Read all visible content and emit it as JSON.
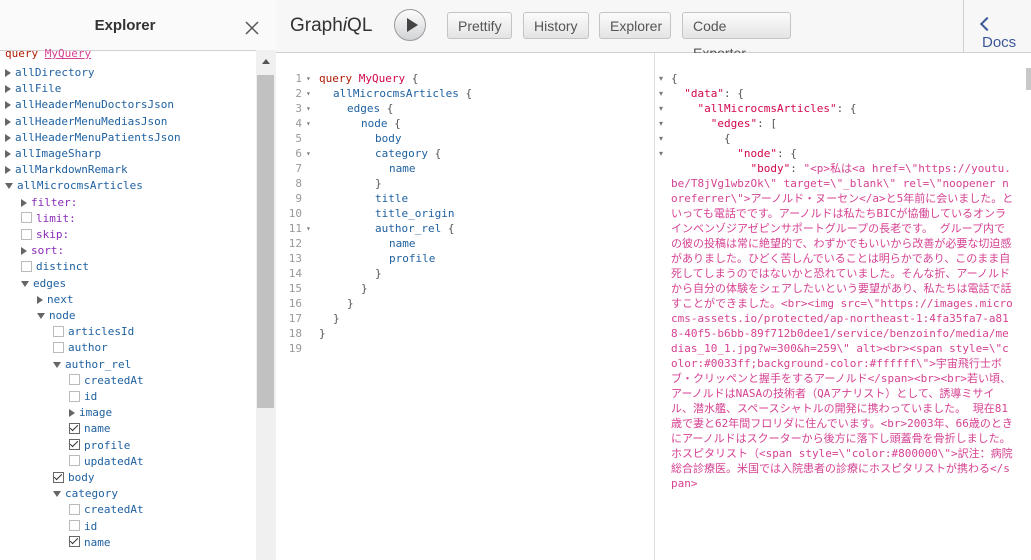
{
  "explorer": {
    "title": "Explorer",
    "query_keyword": "query",
    "query_name": "MyQuery",
    "items": [
      {
        "text": "allDirectory",
        "indent": 0,
        "kind": "arrow-right"
      },
      {
        "text": "allFile",
        "indent": 0,
        "kind": "arrow-right"
      },
      {
        "text": "allHeaderMenuDoctorsJson",
        "indent": 0,
        "kind": "arrow-right"
      },
      {
        "text": "allHeaderMenuMediasJson",
        "indent": 0,
        "kind": "arrow-right"
      },
      {
        "text": "allHeaderMenuPatientsJson",
        "indent": 0,
        "kind": "arrow-right"
      },
      {
        "text": "allImageSharp",
        "indent": 0,
        "kind": "arrow-right"
      },
      {
        "text": "allMarkdownRemark",
        "indent": 0,
        "kind": "arrow-right"
      },
      {
        "text": "allMicrocmsArticles",
        "indent": 0,
        "kind": "arrow-down"
      },
      {
        "text": "filter:",
        "indent": 1,
        "kind": "arrow-right",
        "arg": true
      },
      {
        "text": "limit:",
        "indent": 1,
        "kind": "cb-off",
        "arg": true
      },
      {
        "text": "skip:",
        "indent": 1,
        "kind": "cb-off",
        "arg": true
      },
      {
        "text": "sort:",
        "indent": 1,
        "kind": "arrow-right",
        "arg": true
      },
      {
        "text": "distinct",
        "indent": 1,
        "kind": "cb-off"
      },
      {
        "text": "edges",
        "indent": 1,
        "kind": "arrow-down"
      },
      {
        "text": "next",
        "indent": 2,
        "kind": "arrow-right"
      },
      {
        "text": "node",
        "indent": 2,
        "kind": "arrow-down"
      },
      {
        "text": "articlesId",
        "indent": 3,
        "kind": "cb-off"
      },
      {
        "text": "author",
        "indent": 3,
        "kind": "cb-off"
      },
      {
        "text": "author_rel",
        "indent": 3,
        "kind": "arrow-down"
      },
      {
        "text": "createdAt",
        "indent": 4,
        "kind": "cb-off"
      },
      {
        "text": "id",
        "indent": 4,
        "kind": "cb-off"
      },
      {
        "text": "image",
        "indent": 4,
        "kind": "arrow-right"
      },
      {
        "text": "name",
        "indent": 4,
        "kind": "cb-on"
      },
      {
        "text": "profile",
        "indent": 4,
        "kind": "cb-on"
      },
      {
        "text": "updatedAt",
        "indent": 4,
        "kind": "cb-off"
      },
      {
        "text": "body",
        "indent": 3,
        "kind": "cb-on"
      },
      {
        "text": "category",
        "indent": 3,
        "kind": "arrow-down"
      },
      {
        "text": "createdAt",
        "indent": 4,
        "kind": "cb-off"
      },
      {
        "text": "id",
        "indent": 4,
        "kind": "cb-off"
      },
      {
        "text": "name",
        "indent": 4,
        "kind": "cb-on"
      }
    ]
  },
  "toolbar": {
    "brand_prefix": "Graph",
    "brand_italic": "i",
    "brand_suffix": "QL",
    "prettify": "Prettify",
    "history": "History",
    "explorer": "Explorer",
    "code_exporter": "Code Exporter",
    "docs": "Docs"
  },
  "editor": {
    "lines": [
      {
        "n": "1",
        "fold": true,
        "indent": 0,
        "parts": [
          [
            "kw",
            "query "
          ],
          [
            "def",
            "MyQuery"
          ],
          [
            "pun",
            " {"
          ]
        ]
      },
      {
        "n": "2",
        "fold": true,
        "indent": 1,
        "parts": [
          [
            "prop",
            "allMicrocmsArticles"
          ],
          [
            "pun",
            " {"
          ]
        ]
      },
      {
        "n": "3",
        "fold": true,
        "indent": 2,
        "parts": [
          [
            "prop",
            "edges"
          ],
          [
            "pun",
            " {"
          ]
        ]
      },
      {
        "n": "4",
        "fold": true,
        "indent": 3,
        "parts": [
          [
            "prop",
            "node"
          ],
          [
            "pun",
            " {"
          ]
        ]
      },
      {
        "n": "5",
        "fold": false,
        "indent": 4,
        "parts": [
          [
            "prop",
            "body"
          ]
        ]
      },
      {
        "n": "6",
        "fold": true,
        "indent": 4,
        "parts": [
          [
            "prop",
            "category"
          ],
          [
            "pun",
            " {"
          ]
        ]
      },
      {
        "n": "7",
        "fold": false,
        "indent": 5,
        "parts": [
          [
            "prop",
            "name"
          ]
        ]
      },
      {
        "n": "8",
        "fold": false,
        "indent": 4,
        "parts": [
          [
            "pun",
            "}"
          ]
        ]
      },
      {
        "n": "9",
        "fold": false,
        "indent": 4,
        "parts": [
          [
            "prop",
            "title"
          ]
        ]
      },
      {
        "n": "10",
        "fold": false,
        "indent": 4,
        "parts": [
          [
            "prop",
            "title_origin"
          ]
        ]
      },
      {
        "n": "11",
        "fold": true,
        "indent": 4,
        "parts": [
          [
            "prop",
            "author_rel"
          ],
          [
            "pun",
            " {"
          ]
        ]
      },
      {
        "n": "12",
        "fold": false,
        "indent": 5,
        "parts": [
          [
            "prop",
            "name"
          ]
        ]
      },
      {
        "n": "13",
        "fold": false,
        "indent": 5,
        "parts": [
          [
            "prop",
            "profile"
          ]
        ]
      },
      {
        "n": "14",
        "fold": false,
        "indent": 4,
        "parts": [
          [
            "pun",
            "}"
          ]
        ]
      },
      {
        "n": "15",
        "fold": false,
        "indent": 3,
        "parts": [
          [
            "pun",
            "}"
          ]
        ]
      },
      {
        "n": "16",
        "fold": false,
        "indent": 2,
        "parts": [
          [
            "pun",
            "}"
          ]
        ]
      },
      {
        "n": "17",
        "fold": false,
        "indent": 1,
        "parts": [
          [
            "pun",
            "}"
          ]
        ]
      },
      {
        "n": "18",
        "fold": false,
        "indent": 0,
        "parts": [
          [
            "pun",
            "}"
          ]
        ]
      },
      {
        "n": "19",
        "fold": false,
        "indent": 0,
        "parts": []
      }
    ]
  },
  "result": {
    "line1": "{",
    "line2_key": "\"data\"",
    "line2_rest": ": {",
    "line3_key": "\"allMicrocmsArticles\"",
    "line3_rest": ": {",
    "line4_key": "\"edges\"",
    "line4_rest": ": [",
    "line5": "{",
    "line6_key": "\"node\"",
    "line6_rest": ": {",
    "body_key": "\"body\"",
    "body_sep": ": ",
    "body_value": "\"<p>私は<a href=\\\"https://youtu.be/T8jVg1wbzOk\\\" target=\\\"_blank\\\" rel=\\\"noopener noreferrer\\\">アーノルド・ヌーセン</a>と5年前に会いました。といっても電話でです。アーノルドは私たちBICが協働しているオンラインベンゾジアゼピンサポートグループの長老です。 グループ内での彼の投稿は常に絶望的で、わずかでもいいから改善が必要な切迫感がありました。ひどく苦しんでいることは明らかであり、このまま自死してしまうのではないかと恐れていました。そんな折、アーノルドから自分の体験をシェアしたいという要望があり、私たちは電話で話すことができました。<br><img src=\\\"https://images.microcms-assets.io/protected/ap-northeast-1:4fa35fa7-a818-40f5-b6bb-89f712b0dee1/service/benzoinfo/media/medias_10_1.jpg?w=300&h=259\\\" alt><br><span style=\\\"color:#0033ff;background-color:#ffffff\\\">宇宙飛行士ボブ・クリッペンと握手をするアーノルド</span><br><br>若い頃、アーノルドはNASAの技術者（QAアナリスト）として、誘導ミサイル、潜水艦、スペースシャトルの開発に携わっていました。 現在81歳で妻と62年間フロリダに住んでいます。<br>2003年、66歳のときにアーノルドはスクーターから後方に落下し頭蓋骨を骨折しました。 ホスピタリスト（<span style=\\\"color:#800000\\\">訳注：病院総合診療医。米国では入院患者の診療にホスピタリストが携わる</span>"
  }
}
